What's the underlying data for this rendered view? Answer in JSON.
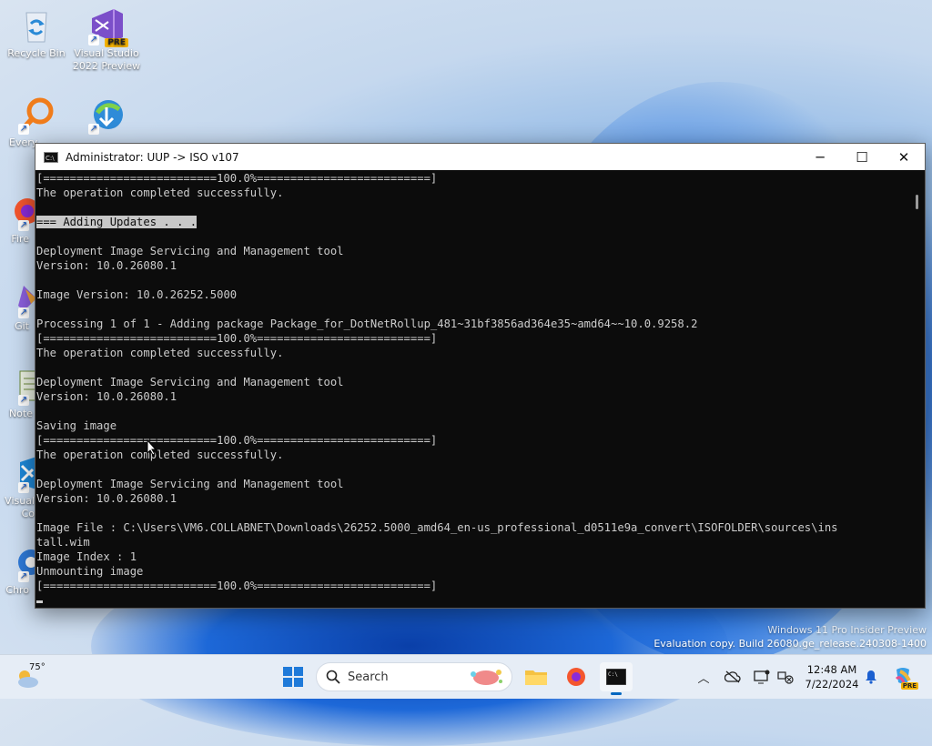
{
  "desktop": {
    "icons": [
      {
        "name": "recycle-bin",
        "label": "Recycle Bin"
      },
      {
        "name": "visual-studio-preview",
        "label": "Visual Studio\n2022 Preview",
        "badge": "PRE"
      },
      {
        "name": "everything",
        "label": "Every"
      },
      {
        "name": "internet-download-manager",
        "label": ""
      },
      {
        "name": "firefox",
        "label": "Fire"
      },
      {
        "name": "github",
        "label": "Git"
      },
      {
        "name": "notepad",
        "label": "Note"
      },
      {
        "name": "visual-studio-code",
        "label": "Visual\nCo"
      },
      {
        "name": "chrome",
        "label": "Chro"
      }
    ],
    "watermark": {
      "line1": "Windows 11 Pro Insider Preview",
      "line2": "Evaluation copy. Build 26080.ge_release.240308-1400"
    }
  },
  "window": {
    "title": "Administrator:  UUP -> ISO v107",
    "minimize_glyph": "─",
    "maximize_glyph": "☐",
    "close_glyph": "✕",
    "lines": [
      "[==========================100.0%==========================]",
      "The operation completed successfully.",
      "",
      "=== Adding Updates . . .",
      "",
      "Deployment Image Servicing and Management tool",
      "Version: 10.0.26080.1",
      "",
      "Image Version: 10.0.26252.5000",
      "",
      "Processing 1 of 1 - Adding package Package_for_DotNetRollup_481~31bf3856ad364e35~amd64~~10.0.9258.2",
      "[==========================100.0%==========================]",
      "The operation completed successfully.",
      "",
      "Deployment Image Servicing and Management tool",
      "Version: 10.0.26080.1",
      "",
      "Saving image",
      "[==========================100.0%==========================]",
      "The operation completed successfully.",
      "",
      "Deployment Image Servicing and Management tool",
      "Version: 10.0.26080.1",
      "",
      "Image File : C:\\Users\\VM6.COLLABNET\\Downloads\\26252.5000_amd64_en-us_professional_d0511e9a_convert\\ISOFOLDER\\sources\\ins",
      "tall.wim",
      "Image Index : 1",
      "Unmounting image",
      "[==========================100.0%==========================]"
    ],
    "selected_line_index": 3
  },
  "taskbar": {
    "weather_temp": "75°",
    "search_placeholder": "Search",
    "clock_time": "12:48 AM",
    "clock_date": "7/22/2024",
    "copilot_badge": "PRE"
  },
  "colors": {
    "console_bg": "#0c0c0c",
    "console_fg": "#cccccc",
    "accent": "#0067c0"
  }
}
